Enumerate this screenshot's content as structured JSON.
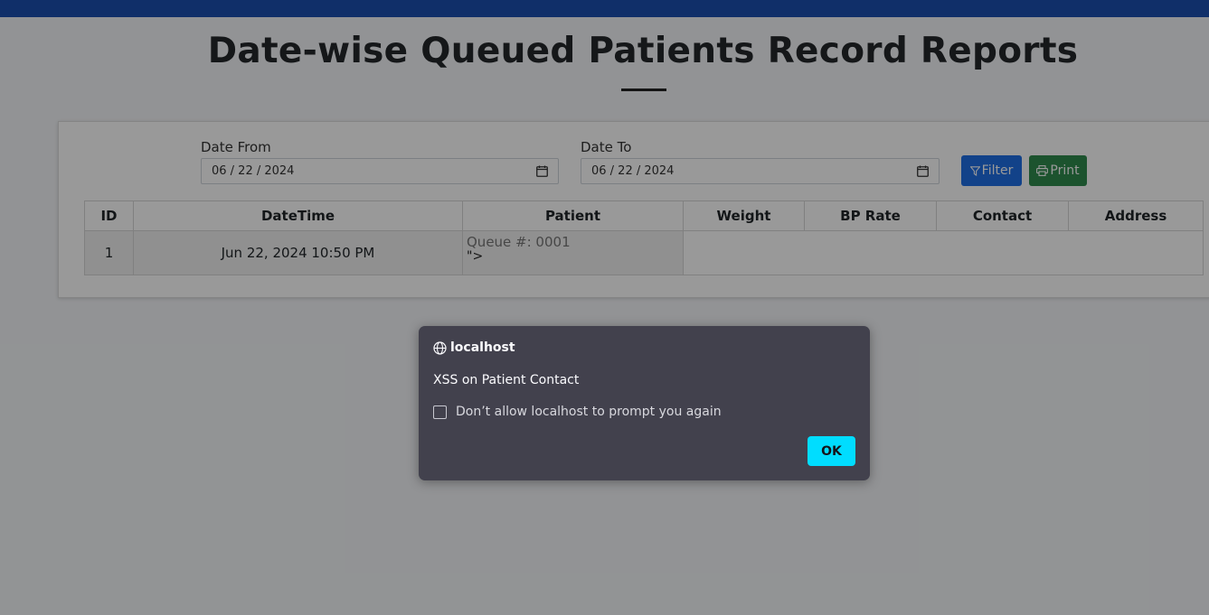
{
  "page": {
    "title": "Date-wise Queued Patients Record Reports"
  },
  "filters": {
    "date_from_label": "Date From",
    "date_from_value": "06 / 22 / 2024",
    "date_to_label": "Date To",
    "date_to_value": "06 / 22 / 2024",
    "filter_button": "Filter",
    "print_button": "Print"
  },
  "table": {
    "columns": [
      "ID",
      "DateTime",
      "Patient",
      "Weight",
      "BP Rate",
      "Contact",
      "Address"
    ],
    "rows": [
      {
        "id": "1",
        "datetime": "Jun 22, 2024 10:50 PM",
        "patient_queue": "Queue #: 0001",
        "patient_tail": "\">"
      }
    ]
  },
  "dialog": {
    "host": "localhost",
    "message": "XSS on Patient Contact",
    "checkbox_label": "Don’t allow localhost to prompt you again",
    "ok_button": "OK"
  },
  "colors": {
    "topbar": "#1b4fb0",
    "filter_button": "#1f6fe5",
    "print_button": "#2f8a4e",
    "dialog_bg": "#42414d",
    "ok_button": "#00ddff"
  }
}
